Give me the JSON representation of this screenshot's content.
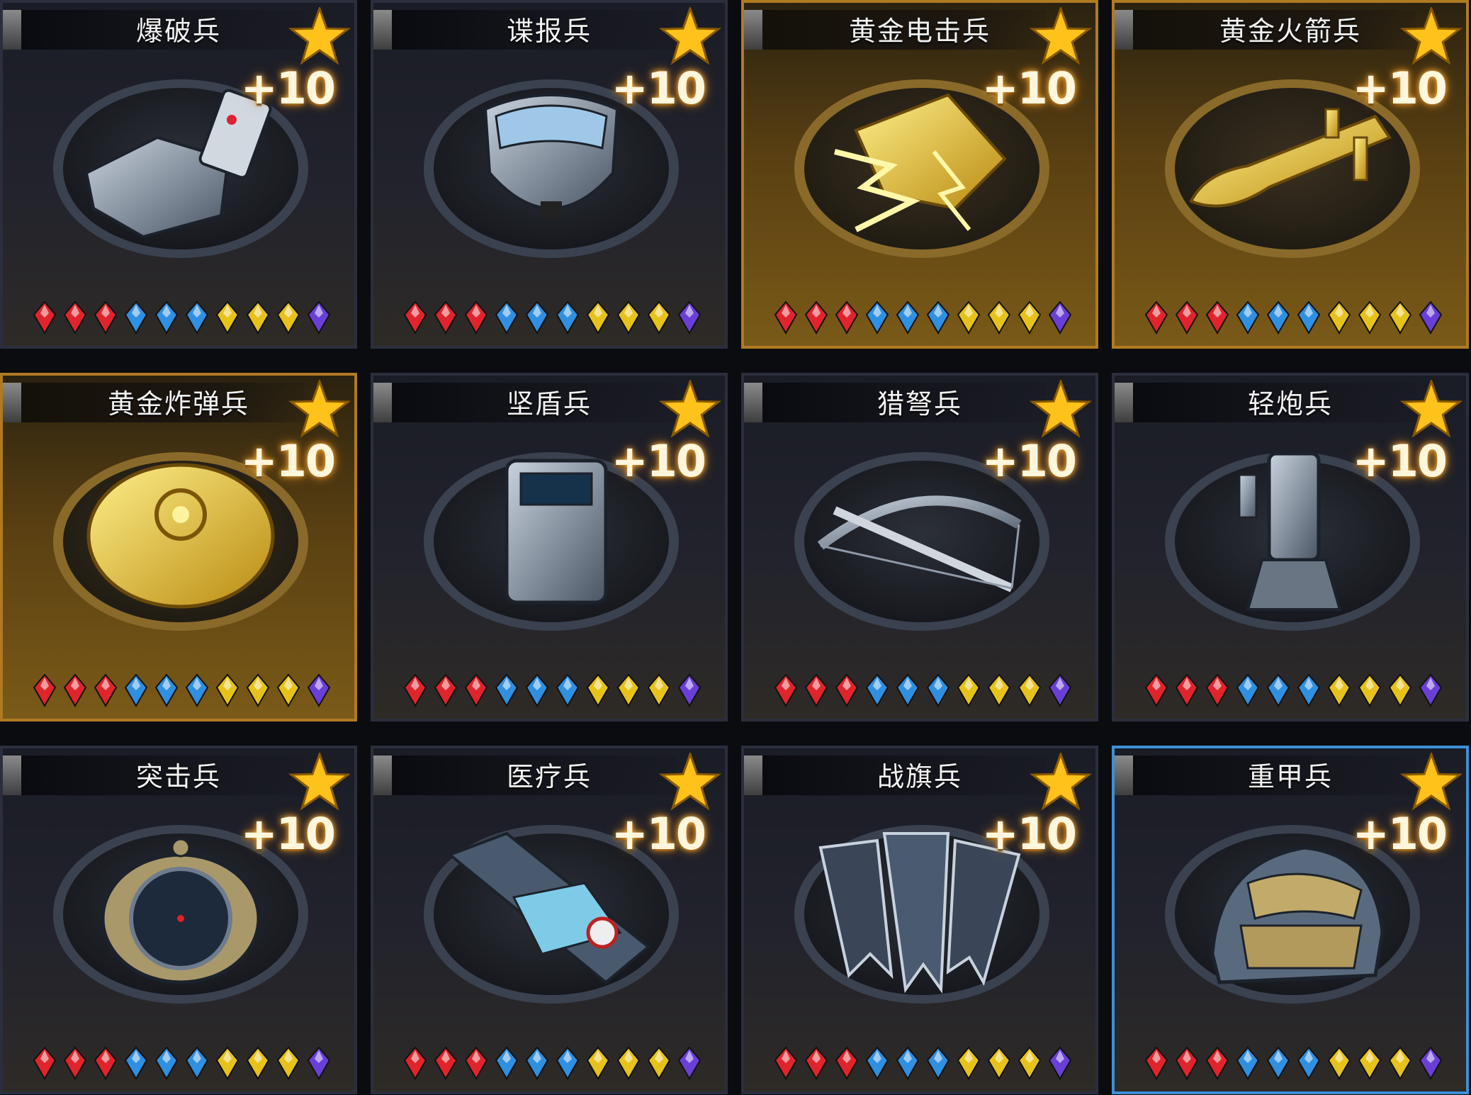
{
  "screen": "unit-card-grid",
  "units": [
    {
      "name": "爆破兵",
      "plus": "+10",
      "gold": false,
      "selected": false,
      "icon": "detonator-icon",
      "gems": [
        "red",
        "red",
        "red",
        "blue",
        "blue",
        "blue",
        "yellow",
        "yellow",
        "yellow",
        "purple"
      ]
    },
    {
      "name": "谍报兵",
      "plus": "+10",
      "gold": false,
      "selected": false,
      "icon": "gas-mask-icon",
      "gems": [
        "red",
        "red",
        "red",
        "blue",
        "blue",
        "blue",
        "yellow",
        "yellow",
        "yellow",
        "purple"
      ]
    },
    {
      "name": "黄金电击兵",
      "plus": "+10",
      "gold": true,
      "selected": false,
      "icon": "lightning-gauntlet-icon",
      "gems": [
        "red",
        "red",
        "red",
        "blue",
        "blue",
        "blue",
        "yellow",
        "yellow",
        "yellow",
        "purple"
      ]
    },
    {
      "name": "黄金火箭兵",
      "plus": "+10",
      "gold": true,
      "selected": false,
      "icon": "rocket-launcher-icon",
      "gems": [
        "red",
        "red",
        "red",
        "blue",
        "blue",
        "blue",
        "yellow",
        "yellow",
        "yellow",
        "purple"
      ]
    },
    {
      "name": "黄金炸弹兵",
      "plus": "+10",
      "gold": true,
      "selected": false,
      "icon": "bomb-icon",
      "gems": [
        "red",
        "red",
        "red",
        "blue",
        "blue",
        "blue",
        "yellow",
        "yellow",
        "yellow",
        "purple"
      ]
    },
    {
      "name": "坚盾兵",
      "plus": "+10",
      "gold": false,
      "selected": false,
      "icon": "riot-shield-icon",
      "gems": [
        "red",
        "red",
        "red",
        "blue",
        "blue",
        "blue",
        "yellow",
        "yellow",
        "yellow",
        "purple"
      ]
    },
    {
      "name": "猎弩兵",
      "plus": "+10",
      "gold": false,
      "selected": false,
      "icon": "crossbow-icon",
      "gems": [
        "red",
        "red",
        "red",
        "blue",
        "blue",
        "blue",
        "yellow",
        "yellow",
        "yellow",
        "purple"
      ]
    },
    {
      "name": "轻炮兵",
      "plus": "+10",
      "gold": false,
      "selected": false,
      "icon": "mortar-icon",
      "gems": [
        "red",
        "red",
        "red",
        "blue",
        "blue",
        "blue",
        "yellow",
        "yellow",
        "yellow",
        "purple"
      ]
    },
    {
      "name": "突击兵",
      "plus": "+10",
      "gold": false,
      "selected": false,
      "icon": "sight-scope-icon",
      "gems": [
        "red",
        "red",
        "red",
        "blue",
        "blue",
        "blue",
        "yellow",
        "yellow",
        "yellow",
        "purple"
      ]
    },
    {
      "name": "医疗兵",
      "plus": "+10",
      "gold": false,
      "selected": false,
      "icon": "medkit-icon",
      "gems": [
        "red",
        "red",
        "red",
        "blue",
        "blue",
        "blue",
        "yellow",
        "yellow",
        "yellow",
        "purple"
      ]
    },
    {
      "name": "战旗兵",
      "plus": "+10",
      "gold": false,
      "selected": false,
      "icon": "war-banners-icon",
      "gems": [
        "red",
        "red",
        "red",
        "blue",
        "blue",
        "blue",
        "yellow",
        "yellow",
        "yellow",
        "purple"
      ]
    },
    {
      "name": "重甲兵",
      "plus": "+10",
      "gold": false,
      "selected": true,
      "icon": "heavy-helmet-icon",
      "gems": [
        "red",
        "red",
        "red",
        "blue",
        "blue",
        "blue",
        "yellow",
        "yellow",
        "yellow",
        "purple"
      ]
    }
  ],
  "colors": {
    "gem_red": "#e0242c",
    "gem_blue": "#2f8fe0",
    "gem_yellow": "#e6c21a",
    "gem_purple": "#6a3fd8",
    "star": "#ffc21a",
    "gold_border": "#b07a22",
    "selected_border": "#3d8fd6"
  }
}
